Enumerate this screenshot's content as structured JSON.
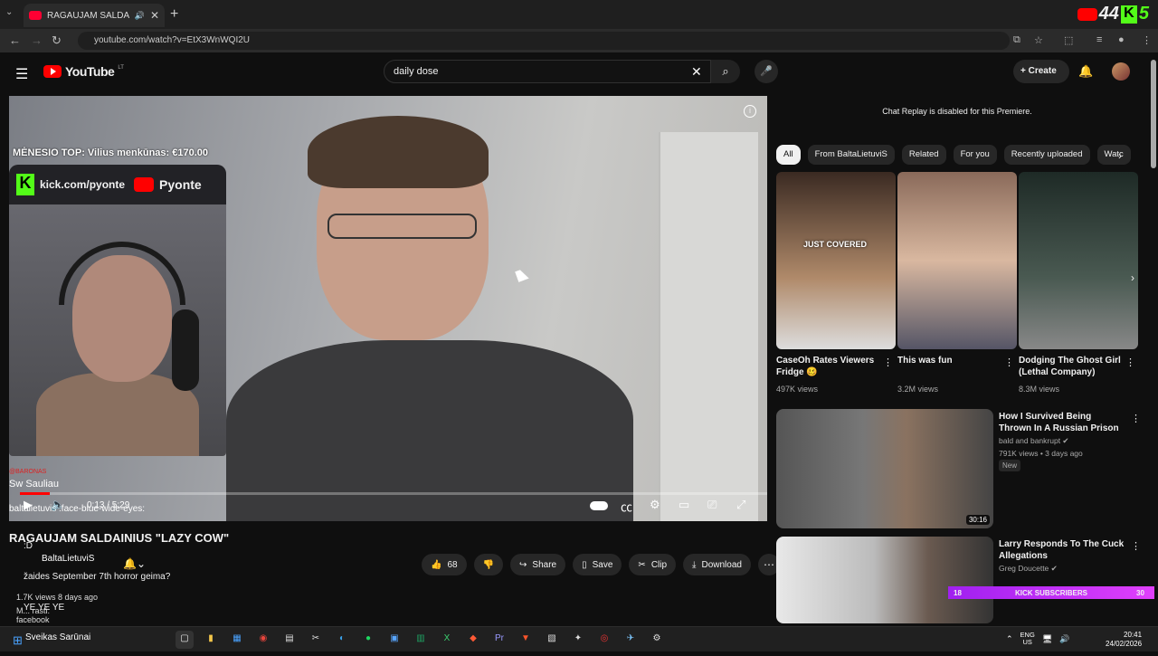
{
  "browser": {
    "tab_title": "RAGAUJAM SALDAINIUS \"L",
    "url": "youtube.com/watch?v=EtX3WnWQI2U",
    "brand_overlay": {
      "number": "44",
      "k_letter": "K",
      "number2": "5"
    }
  },
  "header": {
    "logo_text": "YouTube",
    "logo_region": "LT",
    "search_value": "daily dose",
    "create_label": "Create"
  },
  "player": {
    "top_overlay_text": "MĖNESIO TOP: Vilius menkūnas: €170.00",
    "cam_banner": {
      "kick_url": "kick.com/pyonte",
      "yt_name": "Pyonte"
    },
    "time": "0:13 / 5:29",
    "progress_fraction": 0.04,
    "chat": [
      {
        "user": "@BARONAS",
        "text": "Sw Sauliau"
      },
      {
        "user": "",
        "text": "baltalietuvis :face-blue-wide-eyes:"
      },
      {
        "user": "",
        "text": ":D"
      },
      {
        "user": "",
        "text": "žaides September 7th horror geima?"
      },
      {
        "user": "",
        "text": "YE YE YE"
      },
      {
        "user": "",
        "text": "M... rasti:"
      },
      {
        "user": "",
        "text": "facebook"
      }
    ]
  },
  "video": {
    "title": "RAGAUJAM SALDAINIUS \"LAZY COW\"",
    "channel": "BaltaLietuviS",
    "views": "1.7K views  8 days ago",
    "like_count": "68",
    "share_label": "Share",
    "save_label": "Save",
    "clip_label": "Clip",
    "download_label": "Download"
  },
  "sidebar": {
    "chat_replay_text": "Chat Replay is disabled for this Premiere.",
    "chips": [
      "All",
      "From BaltaLietuviS",
      "Related",
      "For you",
      "Recently uploaded",
      "Watc"
    ],
    "shorts": [
      {
        "title": "CaseOh Rates Viewers Fridge 🥴",
        "views": "497K views",
        "overlay": "JUST COVERED"
      },
      {
        "title": "This was fun",
        "views": "3.2M views",
        "overlay": ""
      },
      {
        "title": "Dodging The Ghost Girl (Lethal Company)",
        "views": "8.3M views",
        "overlay": ""
      }
    ],
    "recommended": [
      {
        "title": "How I Survived Being Thrown In A Russian Prison",
        "channel": "bald and bankrupt ✔",
        "meta": "791K views • 3 days ago",
        "badge": "New",
        "duration": "30:16"
      },
      {
        "title": "Larry Responds To The Cuck Allegations",
        "channel": "Greg Doucette ✔",
        "meta": "",
        "badge": "",
        "duration": ""
      }
    ],
    "kick_subs": {
      "current": "18",
      "label": "KICK SUBSCRIBERS",
      "goal": "30"
    }
  },
  "taskbar": {
    "weather_text": "Sveikas Sarūnai",
    "lang": "ENG",
    "region": "US",
    "time": "20:41",
    "date": "24/02/2026"
  },
  "colors": {
    "accent": "#ff0000",
    "kick": "#53fc18",
    "bg": "#0f0f0f"
  }
}
